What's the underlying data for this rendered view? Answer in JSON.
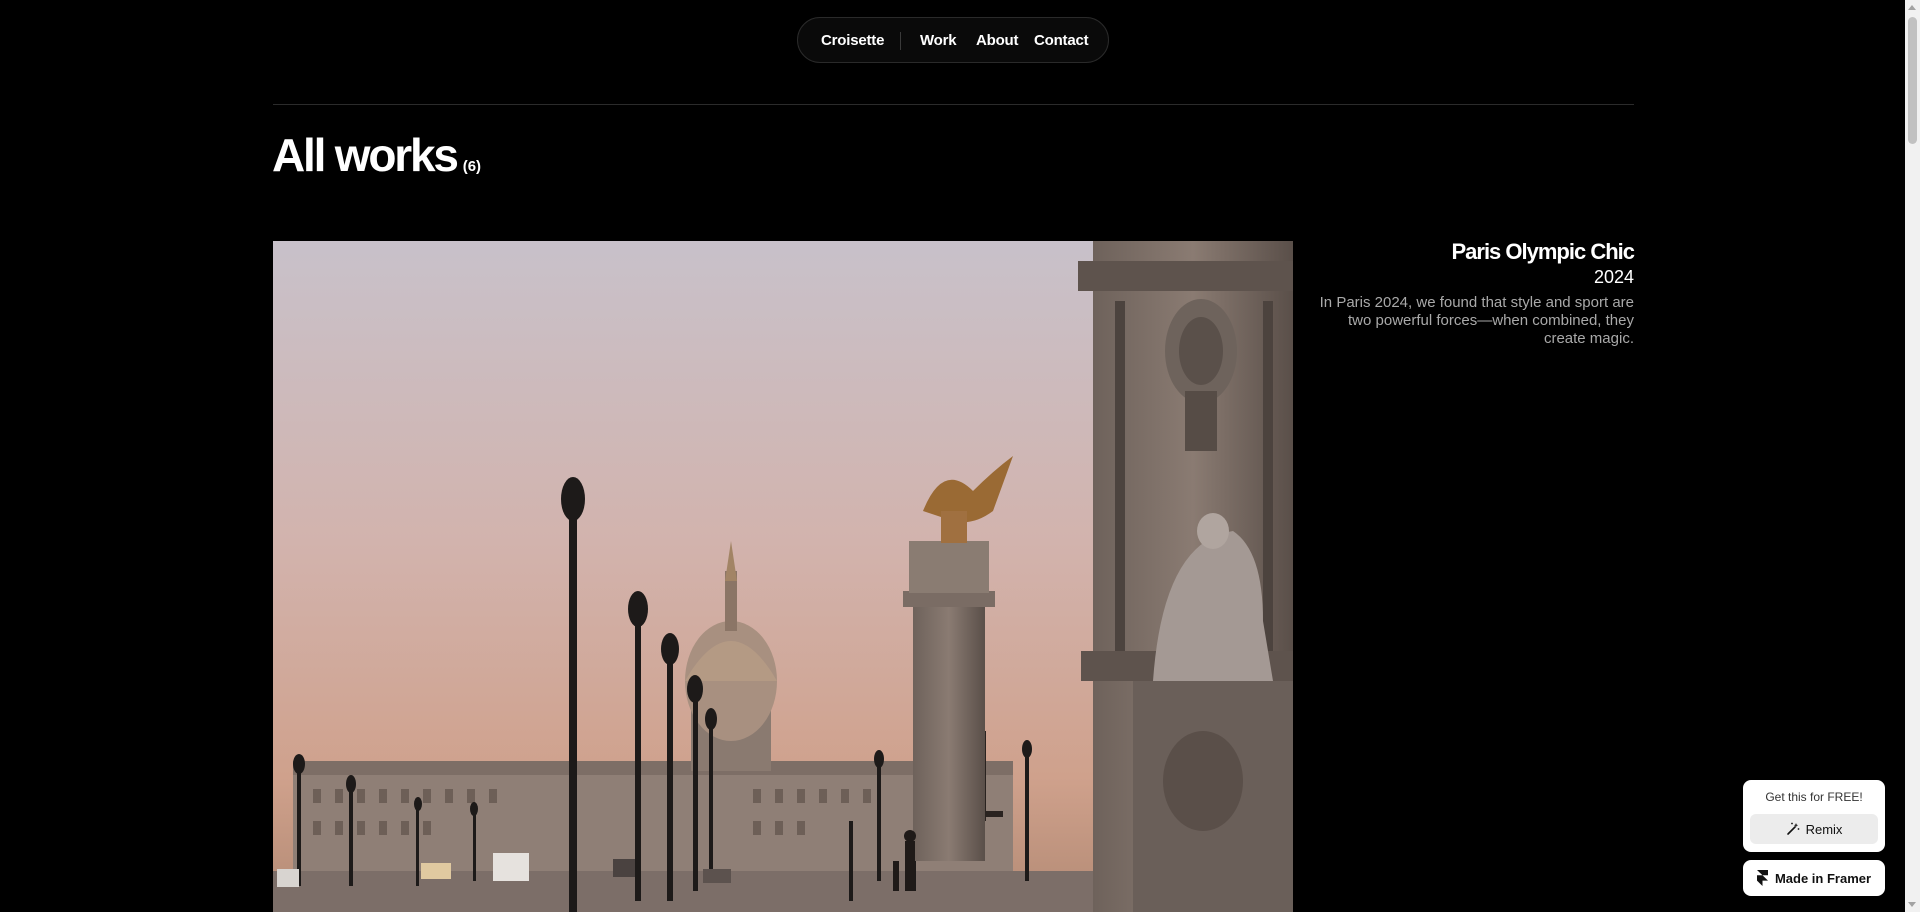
{
  "nav": {
    "brand": "Croisette",
    "links": [
      "Work",
      "About",
      "Contact"
    ]
  },
  "page": {
    "title": "All works",
    "count": "(6)"
  },
  "project": {
    "title": "Paris Olympic Chic",
    "year": "2024",
    "description": "In Paris 2024, we found that style and sport are two powerful forces—when combined, they create magic.",
    "image_alt": "Pont Alexandre III with golden statue and Les Invalides dome at dusk"
  },
  "framer": {
    "promo": "Get this for FREE!",
    "remix_label": "Remix",
    "made_in": "Made in Framer"
  },
  "colors": {
    "background": "#000000",
    "text": "#ffffff",
    "muted": "#a9a9a9"
  }
}
